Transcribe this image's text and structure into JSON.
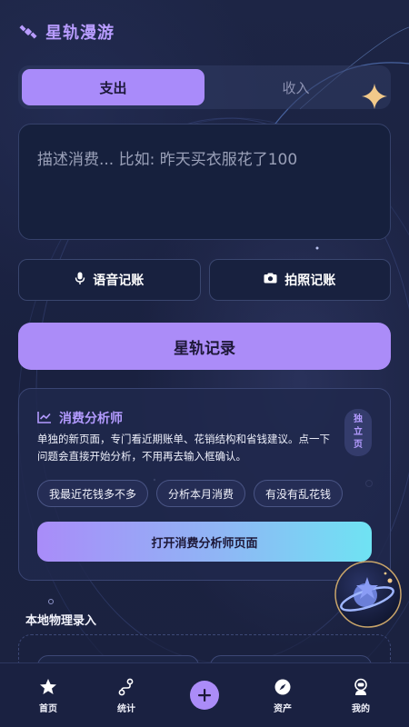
{
  "app": {
    "title": "星轨漫游"
  },
  "tabs": [
    {
      "label": "支出",
      "active": true
    },
    {
      "label": "收入",
      "active": false
    }
  ],
  "description": {
    "placeholder": "描述消费... 比如: 昨天买衣服花了100"
  },
  "actions": {
    "voice_label": "语音记账",
    "photo_label": "拍照记账",
    "record_label": "星轨记录"
  },
  "analyst": {
    "title": "消费分析师",
    "body": "单独的新页面，专门看近期账单、花销结构和省钱建议。点一下问题会直接开始分析，不用再去输入框确认。",
    "badge": [
      "独",
      "立",
      "页"
    ],
    "chips": [
      "我最近花钱多不多",
      "分析本月消费",
      "有没有乱花钱"
    ],
    "open_label": "打开消费分析师页面"
  },
  "local": {
    "title": "本地物理录入"
  },
  "nav": {
    "items": [
      {
        "label": "首页",
        "icon": "star-icon"
      },
      {
        "label": "统计",
        "icon": "route-icon"
      },
      {
        "label": "",
        "icon": "plus-icon"
      },
      {
        "label": "资产",
        "icon": "compass-icon"
      },
      {
        "label": "我的",
        "icon": "astronaut-icon"
      }
    ]
  },
  "colors": {
    "accent": "#ab8cf8",
    "background": "#1b2342",
    "gradient_end": "#6fe3f3",
    "sparkle": "#f2c98a"
  }
}
